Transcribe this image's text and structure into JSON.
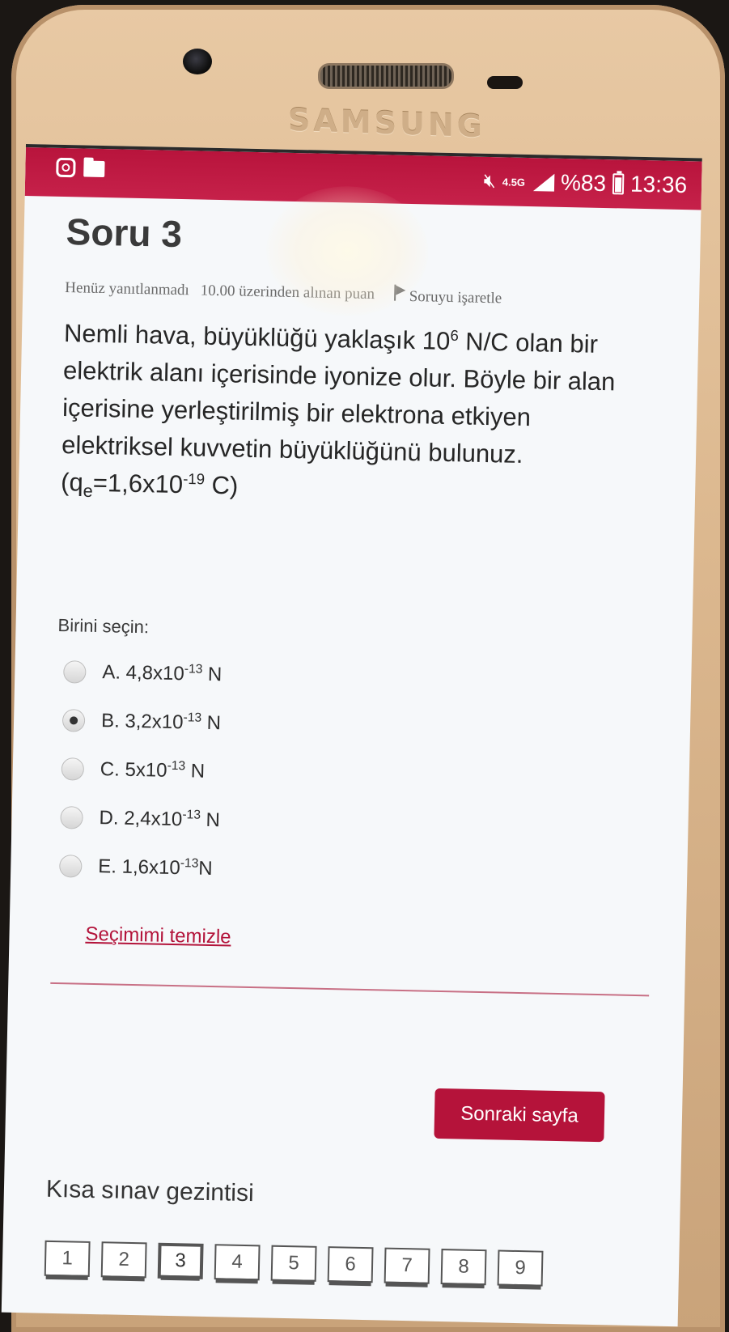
{
  "device": {
    "brand": "SAMSUNG"
  },
  "status_bar": {
    "network": "4.5G",
    "battery": "%83",
    "time": "13:36"
  },
  "quiz": {
    "title": "Soru 3",
    "status": "Henüz yanıtlanmadı",
    "points": "10.00 üzerinden alınan puan",
    "flag_label": "Soruyu işaretle",
    "question": {
      "part1": "Nemli hava, büyüklüğü yaklaşık 10",
      "sup1": "6",
      "part2": " N/C olan bir elektrik alanı içerisinde iyonize olur. Böyle bir alan içerisine yerleştirilmiş bir elektrona etkiyen elektriksel kuvvetin büyüklüğünü bulunuz. (q",
      "sub1": "e",
      "part3": "=1,6x10",
      "sup2": "-19",
      "part4": " C)"
    },
    "prompt": "Birini seçin:",
    "answers": [
      {
        "prefix": "A. 4,8x10",
        "exp": "-13",
        "unit": " N",
        "selected": false
      },
      {
        "prefix": "B. 3,2x10",
        "exp": "-13",
        "unit": " N",
        "selected": true
      },
      {
        "prefix": "C. 5x10",
        "exp": "-13",
        "unit": " N",
        "selected": false
      },
      {
        "prefix": "D. 2,4x10",
        "exp": "-13",
        "unit": " N",
        "selected": false
      },
      {
        "prefix": "E. 1,6x10",
        "exp": "-13",
        "unit": "N",
        "selected": false
      }
    ],
    "clear_label": "Seçimimi temizle",
    "next_label": "Sonraki sayfa",
    "nav_title": "Kısa sınav gezintisi",
    "nav_items": [
      "1",
      "2",
      "3",
      "4",
      "5",
      "6",
      "7",
      "8",
      "9"
    ],
    "current_question": "3"
  },
  "colors": {
    "accent": "#b5133a",
    "status_bar": "#c01b44"
  },
  "icons": [
    "instagram-icon",
    "folder-icon",
    "mute-icon",
    "signal-icon",
    "battery-icon",
    "flag-icon"
  ]
}
